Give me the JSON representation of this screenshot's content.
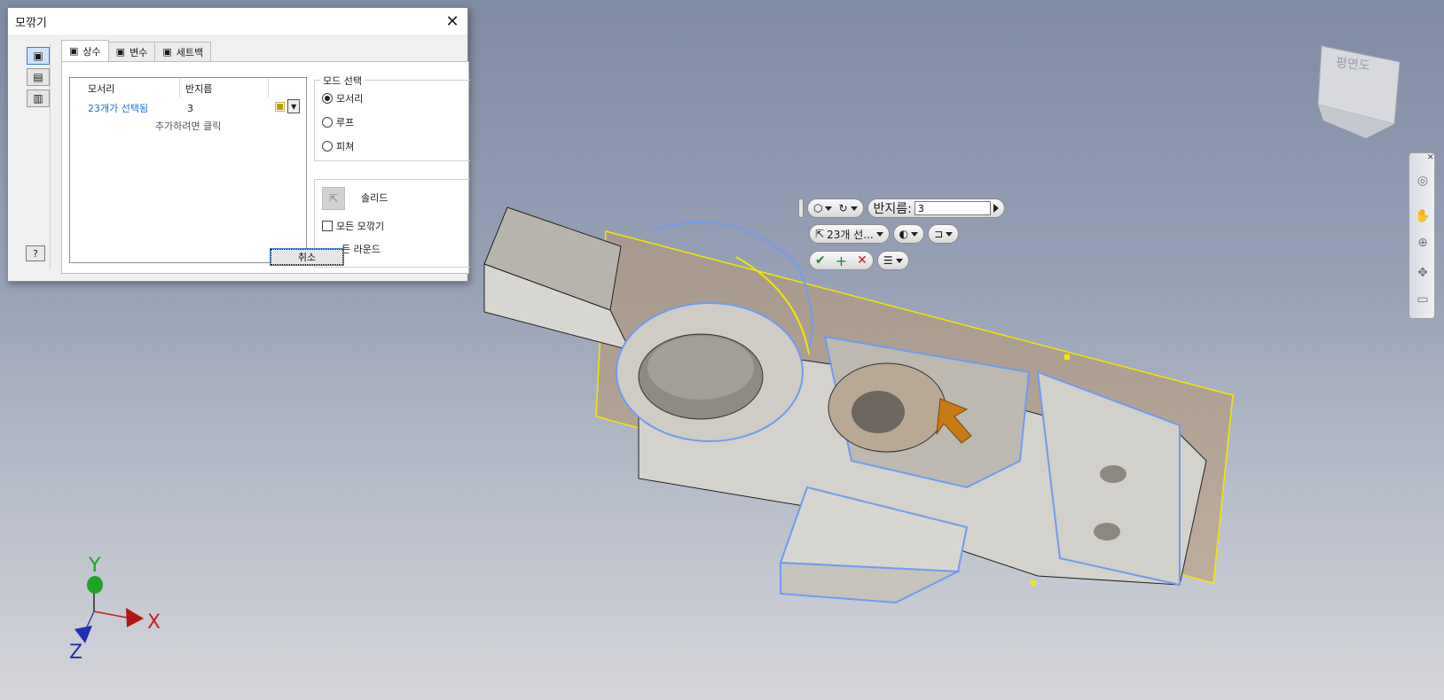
{
  "dialog": {
    "title": "모깎기",
    "tabs": [
      {
        "label": "상수",
        "icon": "constant-fillet-icon"
      },
      {
        "label": "변수",
        "icon": "variable-fillet-icon"
      },
      {
        "label": "세트백",
        "icon": "setback-icon"
      }
    ],
    "table": {
      "col_edge": "모서리",
      "col_radius": "반지름",
      "row_edge": "23개가 선택됨",
      "row_radius": "3",
      "add_hint": "추가하려면 클릭"
    },
    "mode": {
      "legend": "모드 선택",
      "options": [
        "모서리",
        "루프",
        "피쳐"
      ],
      "selected": "모서리"
    },
    "solid_label": "솔리드",
    "all_fillets_label": "모든 모깎기",
    "all_rounds_label": "든 라운드",
    "cancel_label": "취소",
    "help_icon": "?"
  },
  "mini_toolbar": {
    "radius_label": "반지름:",
    "radius_value": "3",
    "selection_label": "23개 선...",
    "apply_icon": "checkmark-icon",
    "add_icon": "plus-icon",
    "cancel_icon": "x-icon"
  },
  "viewcube": {
    "face_label": "평면도"
  },
  "axes": {
    "x": "X",
    "y": "Y",
    "z": "Z"
  },
  "colors": {
    "selection_blue": "#6f9cf0",
    "edge_yellow": "#f3e600",
    "part_grey": "#c9c7c2",
    "arrow_orange": "#c87a14"
  }
}
